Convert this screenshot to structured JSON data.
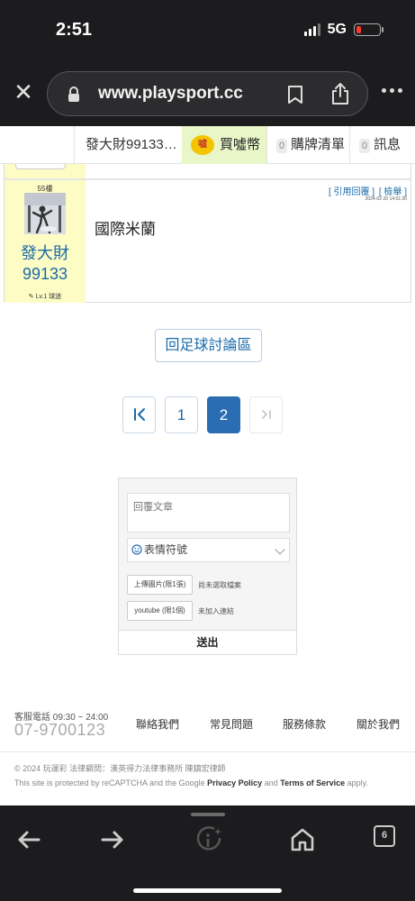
{
  "status_bar": {
    "time": "2:51",
    "network": "5G"
  },
  "browser": {
    "url": "www.playsport.cc",
    "tab_count": "6"
  },
  "header": {
    "user": "發大財99133…",
    "coin_icon_text": "嘘",
    "coin": "買噓幣",
    "cart_count": "0",
    "cart": "購牌清單",
    "msg_count": "0",
    "msg": "訊息"
  },
  "post": {
    "floor": "55樓",
    "username": "發大財99133",
    "level": "Lv.1 球迷",
    "action_quote": "[ 引用回覆 ]",
    "action_report": "[ 檢舉 ]",
    "time": "2024-02-20 14:51:30",
    "content": "國際米蘭"
  },
  "back_button": "回足球討論區",
  "pagination": {
    "first": "|<",
    "pages": [
      "1",
      "2"
    ],
    "current": "2",
    "last": ">|"
  },
  "reply_form": {
    "placeholder": "回覆文章",
    "emoji": "表情符號",
    "upload_image": "上傳圖片(限1張)",
    "upload_note": "尚未選取檔案",
    "youtube": "youtube (限1個)",
    "youtube_note": "未加入連結",
    "submit": "送出"
  },
  "footer": {
    "service_label": "客服電話 09:30 ~ 24:00",
    "phone": "07-9700123",
    "links": [
      "聯絡我們",
      "常見問題",
      "服務條款",
      "關於我們"
    ],
    "legal": "© 2024 玩運彩 法律顧問：漢英得力法律事務所 陳鎮宏律師",
    "captcha_pre": "This site is protected by reCAPTCHA and the Google",
    "privacy": "Privacy Policy",
    "and": "and",
    "terms": "Terms of Service",
    "apply": "apply."
  },
  "icons": {
    "close": "close-icon",
    "lock": "lock-icon",
    "bookmark": "bookmark-icon",
    "share": "share-icon",
    "more": "more-icon",
    "back": "back-arrow-icon",
    "forward": "forward-arrow-icon",
    "assistant": "info-sparkle-icon",
    "home": "home-icon",
    "tabs": "tabs-icon"
  },
  "colors": {
    "accent": "#2a6db3",
    "coin_bg": "#e8f6c8",
    "user_panel": "#fdfcc4",
    "battery_low": "#ff3b30"
  }
}
